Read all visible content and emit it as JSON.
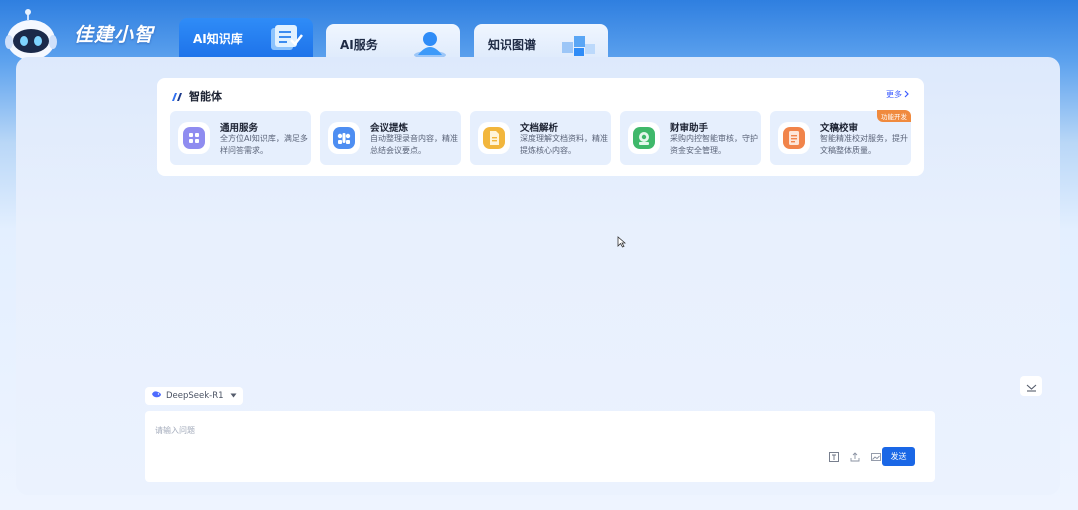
{
  "header": {
    "brand_name": "佳建小智",
    "tabs": [
      {
        "label": "AI知识库",
        "active": true
      },
      {
        "label": "AI服务",
        "active": false
      },
      {
        "label": "知识图谱",
        "active": false
      }
    ]
  },
  "agents": {
    "title": "智能体",
    "more_label": "更多",
    "items": [
      {
        "title": "通用服务",
        "desc": "全方位AI知识库，满足多样问答需求。",
        "color": "#8f8cf0",
        "icon": "grid-icon"
      },
      {
        "title": "会议提炼",
        "desc": "自动整理录音内容，精准总结会议要点。",
        "color": "#4e8ef2",
        "icon": "meeting-icon"
      },
      {
        "title": "文档解析",
        "desc": "深度理解文档资料，精准提炼核心内容。",
        "color": "#f2b63c",
        "icon": "document-icon"
      },
      {
        "title": "财审助手",
        "desc": "采购内控智能审核，守护资金安全管理。",
        "color": "#3fb86a",
        "icon": "audit-icon"
      },
      {
        "title": "文稿校审",
        "desc": "智能精准校对服务，提升文稿整体质量。",
        "color": "#f1844a",
        "icon": "proofread-icon",
        "badge": "功能开发"
      }
    ]
  },
  "chat": {
    "model": "DeepSeek-R1",
    "placeholder": "请输入问题",
    "send_label": "发送"
  },
  "colors": {
    "accent": "#1a67e6",
    "active_tab": "#2f8cf7",
    "card_bg": "#e6effd"
  }
}
